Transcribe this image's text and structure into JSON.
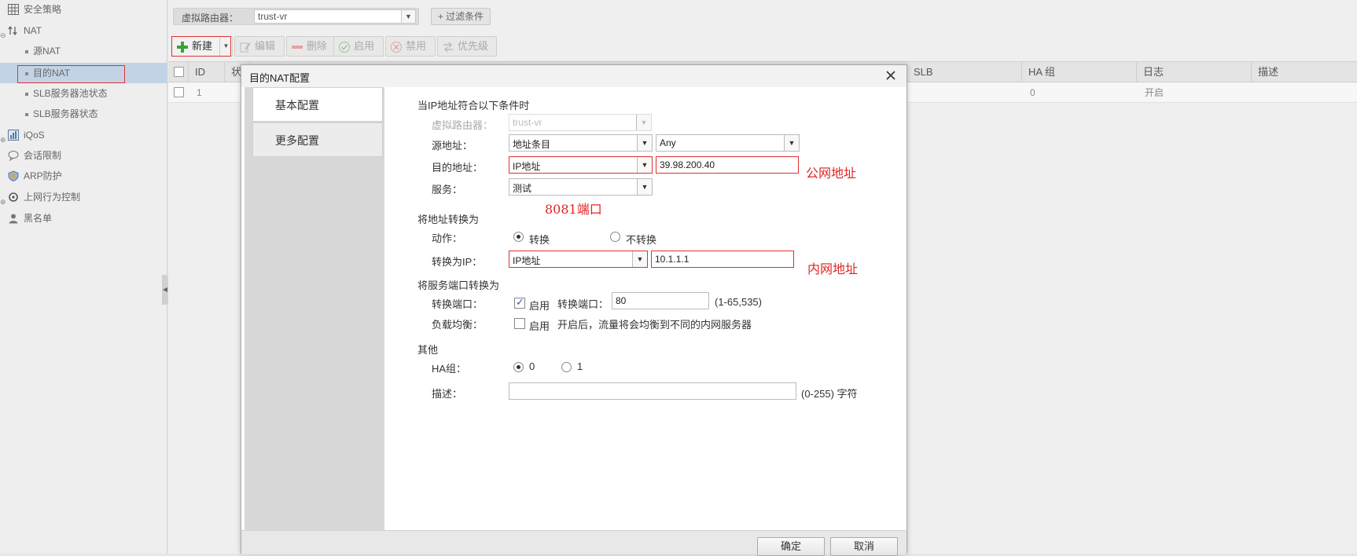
{
  "sidebar": {
    "items": [
      {
        "label": "安全策略",
        "icon": "grid-icon"
      },
      {
        "label": "NAT",
        "icon": "nat-icon"
      },
      {
        "label": "源NAT"
      },
      {
        "label": "目的NAT"
      },
      {
        "label": "SLB服务器池状态"
      },
      {
        "label": "SLB服务器状态"
      },
      {
        "label": "iQoS",
        "icon": "qos-icon"
      },
      {
        "label": "会话限制",
        "icon": "chat-icon"
      },
      {
        "label": "ARP防护",
        "icon": "shield-icon"
      },
      {
        "label": "上网行为控制",
        "icon": "behavior-icon"
      },
      {
        "label": "黑名单",
        "icon": "user-icon"
      }
    ]
  },
  "filter": {
    "virtual_router_label": "虚拟路由器：",
    "virtual_router_value": "trust-vr",
    "add_filter_label": "+ 过滤条件"
  },
  "toolbar": {
    "new_label": "新建",
    "edit_label": "编辑",
    "delete_label": "删除",
    "enable_label": "启用",
    "disable_label": "禁用",
    "priority_label": "优先级"
  },
  "grid": {
    "columns": [
      "ID",
      "状",
      "SLB",
      "HA 组",
      "日志",
      "描述"
    ],
    "rows": [
      {
        "id": "1",
        "ha": "0",
        "log": "开启"
      }
    ]
  },
  "dialog": {
    "title": "目的NAT配置",
    "tabs": [
      "基本配置",
      "更多配置"
    ],
    "section_match": "当IP地址符合以下条件时",
    "virtual_router_label": "虚拟路由器：",
    "virtual_router_value": "trust-vr",
    "source_label": "源地址：",
    "source_type": "地址条目",
    "source_value": "Any",
    "dest_label": "目的地址：",
    "dest_type": "IP地址",
    "dest_value": "39.98.200.40",
    "service_label": "服务：",
    "service_value": "测试",
    "section_translate": "将地址转换为",
    "action_label": "动作：",
    "action_translate": "转换",
    "action_no_translate": "不转换",
    "translate_ip_label": "转换为IP：",
    "translate_ip_type": "IP地址",
    "translate_ip_value": "10.1.1.1",
    "section_port": "将服务端口转换为",
    "port_translate_label": "转换端口：",
    "port_enable_label": "启用",
    "port_field_label": "转换端口：",
    "port_value": "80",
    "port_range_hint": "(1-65,535)",
    "lb_label": "负载均衡：",
    "lb_enable_label": "启用",
    "lb_hint": "开启后，流量将会均衡到不同的内网服务器",
    "section_other": "其他",
    "ha_label": "HA组：",
    "ha_option_0": "0",
    "ha_option_1": "1",
    "desc_label": "描述：",
    "desc_value": "",
    "desc_hint": "(0-255) 字符",
    "ok_label": "确定",
    "cancel_label": "取消"
  },
  "annotations": {
    "public_address": "公网地址",
    "port_8081": "8081端口",
    "private_address": "内网地址"
  },
  "colors": {
    "annotation_red": "#e02424",
    "selected_row": "#c2d3e6",
    "new_icon_green": "#3aa335"
  }
}
